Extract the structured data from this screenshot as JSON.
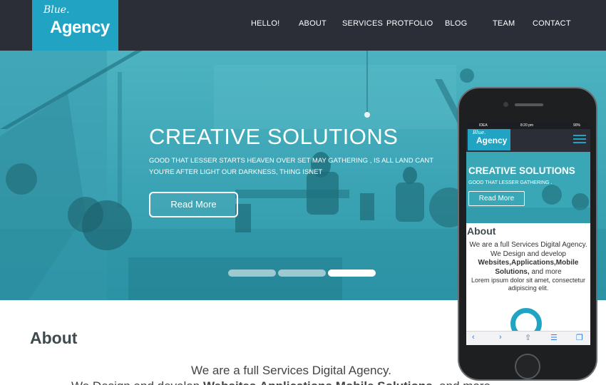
{
  "header": {
    "logo_script": "Blue.",
    "logo_main": "Agency",
    "nav": [
      "HELLO!",
      "ABOUT",
      "SERVICES",
      "PROTFOLIO",
      "BLOG",
      "TEAM",
      "CONTACT"
    ]
  },
  "hero": {
    "title": "CREATIVE SOLUTIONS",
    "subtitle_line1": "GOOD THAT LESSER  STARTS HEAVEN OVER SET MAY GATHERING , IS ALL LAND CANT",
    "subtitle_line2": "YOU'RE AFTER LIGHT OUR DARKNESS, THING ISNET",
    "button": "Read More",
    "slides_total": 3,
    "slide_active": 3
  },
  "about": {
    "title": "About",
    "line1": "We are a full Services Digital Agency.",
    "line2_start": "We Design and develop",
    "line2_bold": "Websites,Applications,Mobile Solutions,",
    "line2_end": "and more"
  },
  "phone": {
    "status": {
      "carrier": "IDEA",
      "time": "8:20 pm",
      "battery": "90%"
    },
    "logo_script": "Blue.",
    "logo_main": "Agency",
    "hero_title": "CREATIVE SOLUTIONS",
    "hero_sub": "GOOD THAT LESSER GATHERING .",
    "hero_button": "Read More",
    "about_title": "About",
    "about_line1": "We are a full Services Digital Agency.",
    "about_line2": "We Design and develop",
    "about_bold": "Websites,Applications,Mobile Solutions,",
    "about_more": "and more",
    "about_lorem": "Lorem ipsum dolor sit amet, consectetur adipiscing elit.",
    "toolbar": [
      "back-icon",
      "forward-icon",
      "share-icon",
      "bookmarks-icon",
      "tabs-icon"
    ]
  },
  "colors": {
    "accent": "#21a4c4",
    "header_bg": "#2b2e36",
    "hero_tint": "#36a3b4"
  }
}
